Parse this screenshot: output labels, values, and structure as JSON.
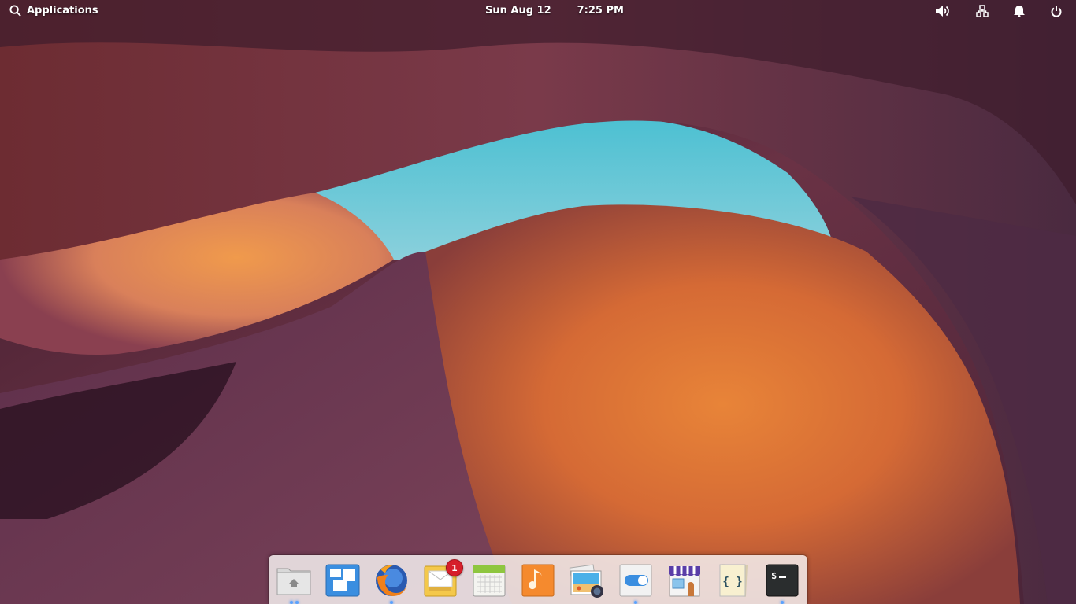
{
  "panel": {
    "applications_label": "Applications",
    "date": "Sun Aug 12",
    "time": "7:25 PM",
    "indicators": [
      {
        "name": "volume",
        "icon": "volume-icon"
      },
      {
        "name": "network",
        "icon": "network-icon"
      },
      {
        "name": "notifications",
        "icon": "bell-icon"
      },
      {
        "name": "session",
        "icon": "power-icon"
      }
    ]
  },
  "dock": {
    "items": [
      {
        "app": "Files",
        "icon": "folder-home-icon",
        "running_windows": 2
      },
      {
        "app": "Multitasking View",
        "icon": "multitasking-icon",
        "running_windows": 0
      },
      {
        "app": "Firefox",
        "icon": "firefox-icon",
        "running_windows": 1
      },
      {
        "app": "Mail",
        "icon": "mail-icon",
        "running_windows": 0,
        "badge": "1"
      },
      {
        "app": "Calendar",
        "icon": "calendar-icon",
        "running_windows": 0
      },
      {
        "app": "Music",
        "icon": "music-icon",
        "running_windows": 0
      },
      {
        "app": "Photos",
        "icon": "photos-icon",
        "running_windows": 0
      },
      {
        "app": "System Settings",
        "icon": "settings-toggle-icon",
        "running_windows": 1
      },
      {
        "app": "AppCenter",
        "icon": "appcenter-icon",
        "running_windows": 0
      },
      {
        "app": "Code",
        "icon": "code-icon",
        "running_windows": 0
      },
      {
        "app": "Terminal",
        "icon": "terminal-icon",
        "running_windows": 1
      }
    ]
  },
  "colors": {
    "accent_dot": "#5aa3ff",
    "badge": "#d61e2a",
    "sky": "#6ec9d8"
  }
}
